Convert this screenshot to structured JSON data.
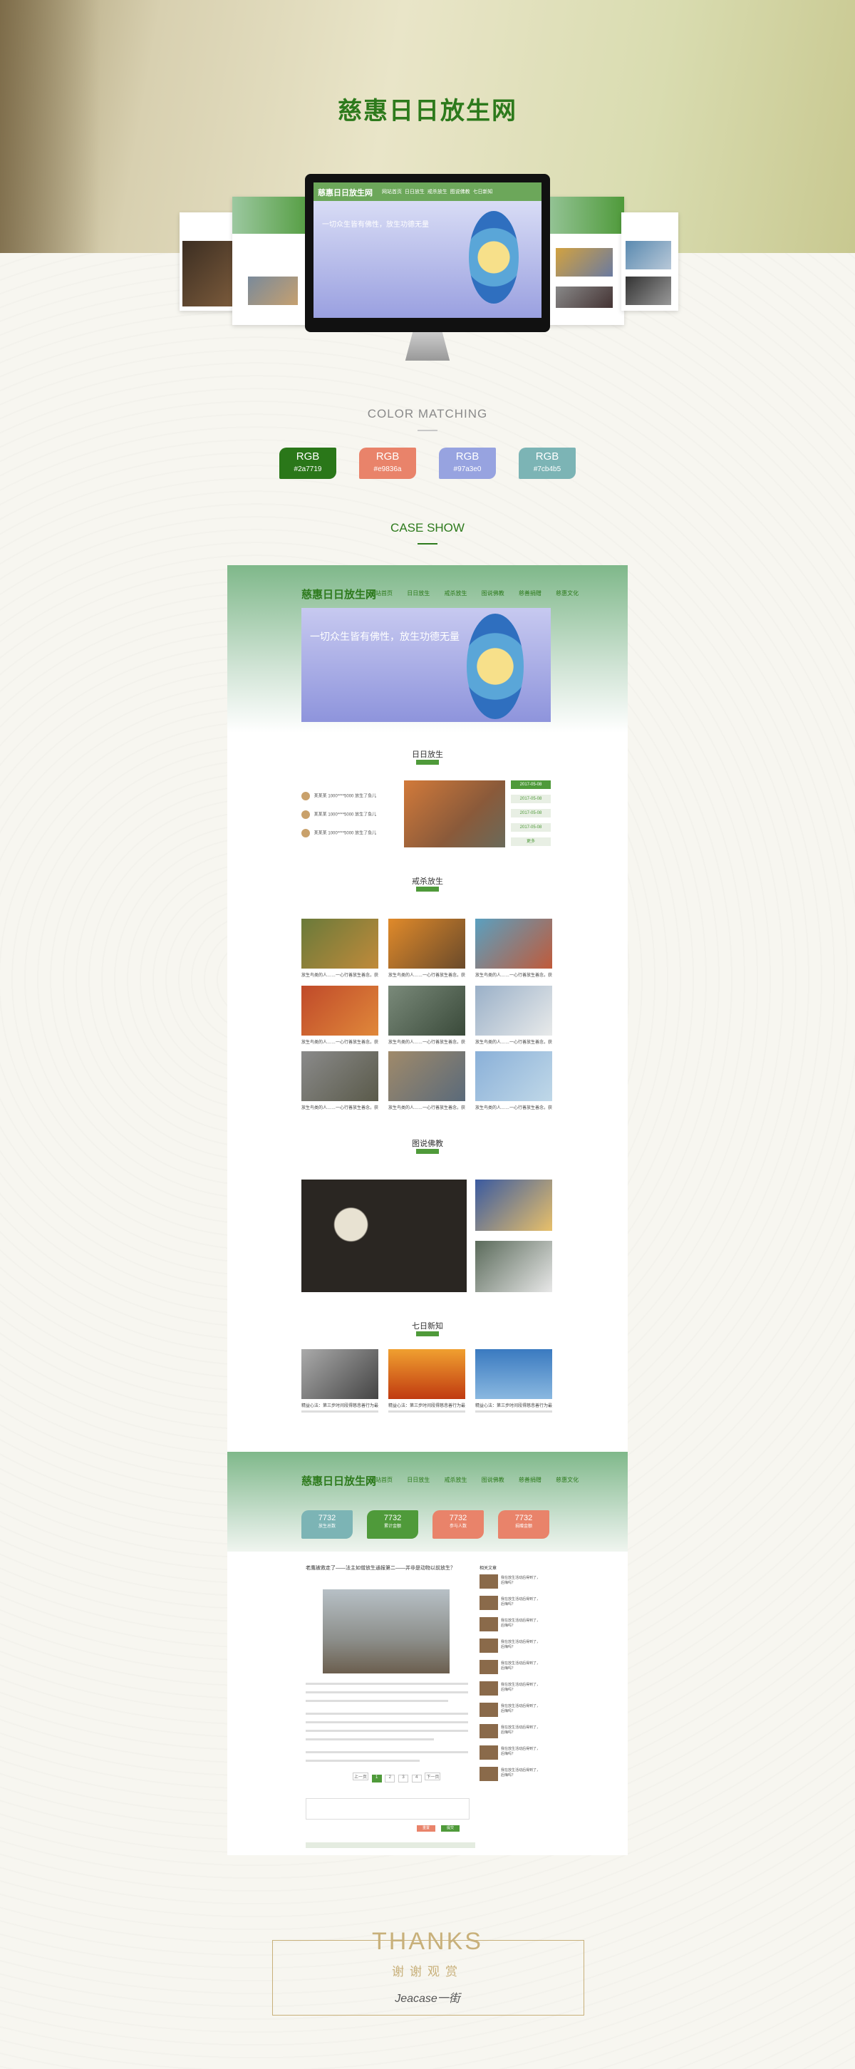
{
  "header": {
    "site_title": "慈惠日日放生网"
  },
  "mockup": {
    "brand": "慈惠日日放生网",
    "nav": [
      "网站首页",
      "日日放生",
      "戒杀放生",
      "图说佛教",
      "七日新知",
      "慈善捐赠",
      "慈惠文化"
    ],
    "banner_text": "一切众生皆有佛性，放生功德无量"
  },
  "color_matching": {
    "title": "COLOR  MATCHING",
    "swatches": [
      {
        "label": "RGB",
        "code": "#2a7719",
        "color": "#2a7719"
      },
      {
        "label": "RGB",
        "code": "#e9836a",
        "color": "#e9836a"
      },
      {
        "label": "RGB",
        "code": "#97a3e0",
        "color": "#97a3e0"
      },
      {
        "label": "RGB",
        "code": "#7cb4b5",
        "color": "#7cb4b5"
      }
    ]
  },
  "case_show": {
    "title": "CASE SHOW",
    "sections": {
      "daily": "日日放生",
      "ban": "戒杀放生",
      "pic": "图说佛教",
      "news": "七日新知"
    },
    "daily_rows": [
      {
        "name": "某某某",
        "amount": "1000****5000",
        "note": "放生了鱼儿"
      },
      {
        "name": "某某某",
        "amount": "1000****5000",
        "note": "放生了鱼儿"
      },
      {
        "name": "某某某",
        "amount": "1000****5000",
        "note": "放生了鱼儿"
      }
    ],
    "dates": [
      "2017-05-08",
      "2017-05-08",
      "2017-05-08",
      "2017-05-08",
      "更多"
    ],
    "grid_caption": "放生鸟类的人……一心行善放生善念，获福！",
    "news_caption": "精益心法：第三步时间段得慈悲善行为最好了面，……",
    "stats": [
      {
        "value": "7732",
        "label": "放生总数",
        "color": "#7cb4b5"
      },
      {
        "value": "7732",
        "label": "累计金额",
        "color": "#4f9a3a"
      },
      {
        "value": "7732",
        "label": "参与人数",
        "color": "#e9836a"
      },
      {
        "value": "7732",
        "label": "捐赠金额",
        "color": "#e9836a"
      }
    ],
    "article_title": "老鹰被救走了——法主如僧放生通报第二——并非是动物以前放生？",
    "sidebar_title": "相关文章",
    "sidebar_item": "我在放生活动后得到了，后悔吗？",
    "pager": [
      "上一页",
      "1",
      "2",
      "3",
      "4",
      "下一页"
    ],
    "buttons": {
      "reset": "重置",
      "submit": "提交"
    }
  },
  "thanks": {
    "title": "THANKS",
    "subtitle": "谢谢观赏",
    "brand": "Jeacase一街"
  }
}
